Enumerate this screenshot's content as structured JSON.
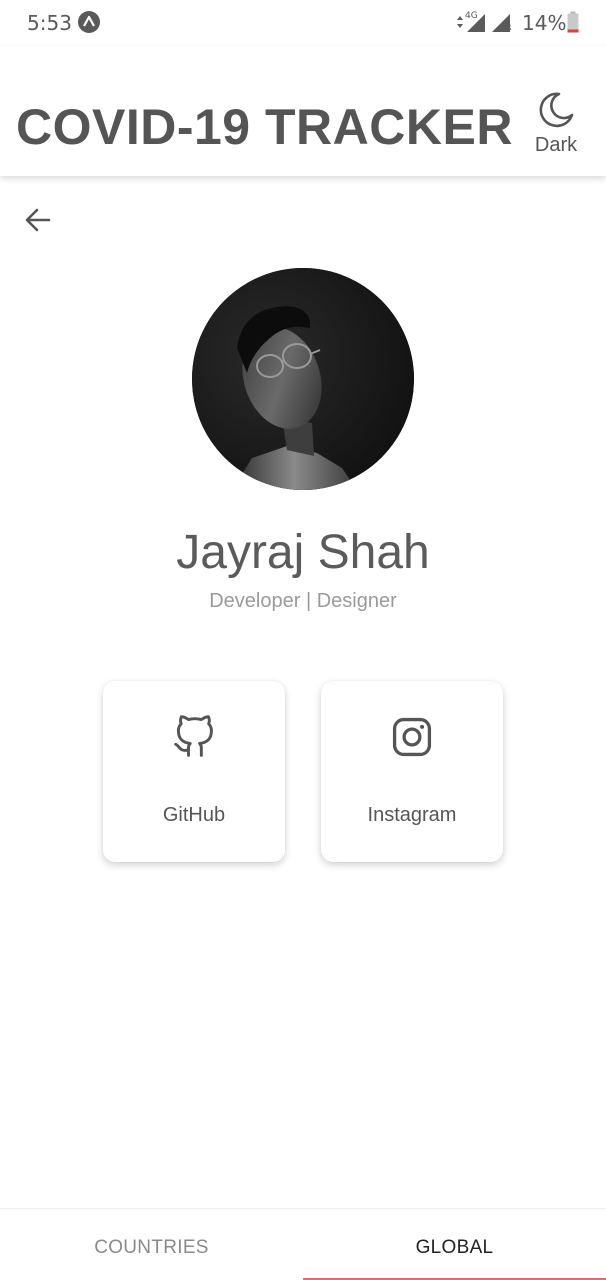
{
  "status_bar": {
    "time": "5:53",
    "network": "4G",
    "roaming": "R",
    "battery": "14%",
    "battery_color": "#e0403a"
  },
  "app_bar": {
    "title": "COVID-19 TRACKER",
    "theme_toggle_label": "Dark",
    "theme_icon": "moon-icon"
  },
  "profile": {
    "back_icon": "arrow-left-icon",
    "name": "Jayraj Shah",
    "role": "Developer | Designer"
  },
  "links": [
    {
      "label": "GitHub",
      "icon": "github-icon"
    },
    {
      "label": "Instagram",
      "icon": "instagram-icon"
    }
  ],
  "tabs": [
    {
      "label": "COUNTRIES",
      "selected": false
    },
    {
      "label": "GLOBAL",
      "selected": true
    }
  ],
  "colors": {
    "accent": "#e06a66",
    "text_primary": "#555555",
    "text_secondary": "#9a9a9a"
  }
}
